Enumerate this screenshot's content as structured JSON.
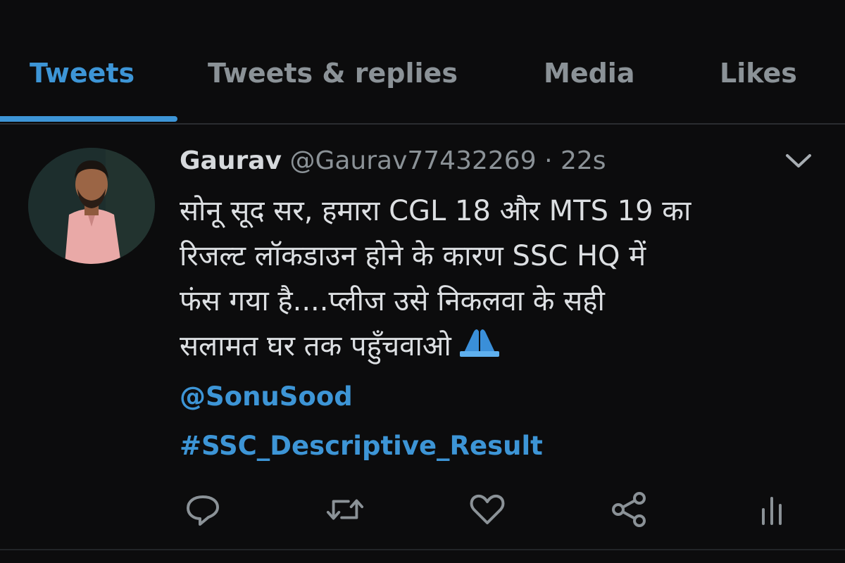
{
  "tabs": [
    {
      "label": "Tweets",
      "active": true
    },
    {
      "label": "Tweets & replies",
      "active": false
    },
    {
      "label": "Media",
      "active": false
    },
    {
      "label": "Likes",
      "active": false
    }
  ],
  "tweet": {
    "author_name": "Gaurav",
    "author_handle": "@Gaurav77432269",
    "separator": "·",
    "time": "22s",
    "body_lines": [
      "सोनू सूद सर, हमारा CGL 18 और MTS 19 का",
      "रिजल्ट लॉकडाउन होने के कारण SSC HQ में",
      "फंस गया है....प्लीज उसे निकलवा के सही",
      "सलामत घर तक पहुँचवाओ"
    ],
    "emoji": "folded-hands-emoji",
    "mention": "@SonuSood",
    "hashtag": "#SSC_Descriptive_Result"
  },
  "actions": [
    {
      "icon": "reply-icon"
    },
    {
      "icon": "retweet-icon"
    },
    {
      "icon": "like-icon"
    },
    {
      "icon": "share-icon"
    },
    {
      "icon": "analytics-icon"
    }
  ],
  "colors": {
    "background": "#0c0c0d",
    "accent": "#3d95d6",
    "text_primary": "#dcdfe2",
    "text_secondary": "#8b9297"
  }
}
